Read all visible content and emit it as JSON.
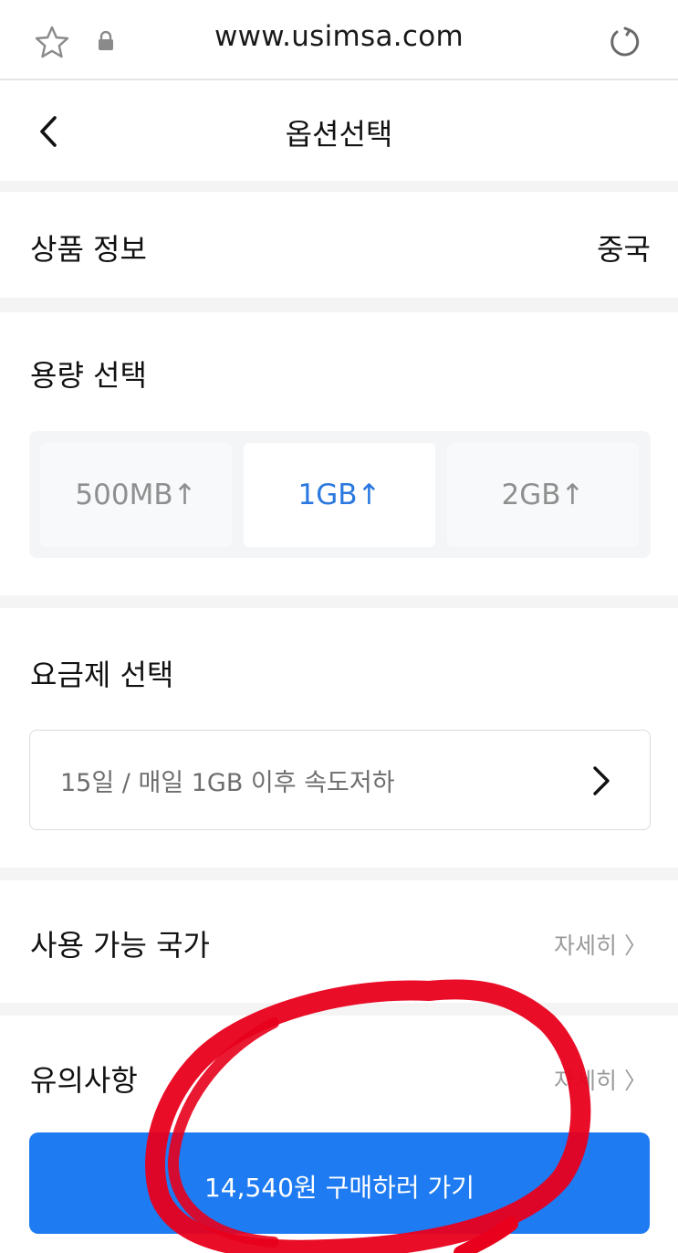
{
  "browser": {
    "url": "www.usimsa.com"
  },
  "header": {
    "title": "옵션선택"
  },
  "product_info": {
    "label": "상품 정보",
    "value": "중국"
  },
  "capacity": {
    "label": "용량 선택",
    "options": [
      "500MB↑",
      "1GB↑",
      "2GB↑"
    ],
    "selected": "1GB↑"
  },
  "plan": {
    "label": "요금제 선택",
    "selected_value": "15일 / 매일 1GB 이후 속도저하"
  },
  "countries": {
    "label": "사용 가능 국가",
    "link": "자세히 〉"
  },
  "notice": {
    "label": "유의사항",
    "link": "자세히 〉"
  },
  "buy_button": {
    "label": "14,540원 구매하러 가기"
  },
  "colors": {
    "accent": "#1e7bf2",
    "selected_text": "#2a78e0",
    "annotation": "#e8001c"
  },
  "icons": [
    "star-icon",
    "lock-icon",
    "reload-icon",
    "back-icon",
    "chevron-right-icon"
  ]
}
